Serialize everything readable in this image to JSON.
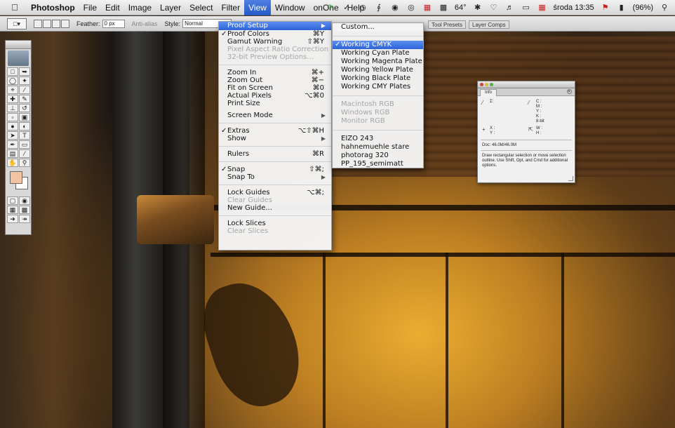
{
  "menubar": {
    "app_name": "Photoshop",
    "menus": [
      "File",
      "Edit",
      "Image",
      "Layer",
      "Select",
      "Filter",
      "View",
      "Window",
      "onOne",
      "Help"
    ],
    "active_menu": "View",
    "status": {
      "temperature": "64°",
      "clock": "środa 13:35",
      "battery": "(96%)"
    }
  },
  "options_bar": {
    "feather_label": "Feather:",
    "feather_value": "0 px",
    "antialias_label": "Anti-alias",
    "style_label": "Style:",
    "style_value": "Normal",
    "palette_tabs": [
      "Tool Presets",
      "Layer Comps"
    ]
  },
  "view_menu": {
    "items": [
      {
        "label": "Proof Setup",
        "shortcut": "",
        "submenu": true,
        "selected": true
      },
      {
        "label": "Proof Colors",
        "shortcut": "⌘Y",
        "checked": true
      },
      {
        "label": "Gamut Warning",
        "shortcut": "⇧⌘Y"
      },
      {
        "label": "Pixel Aspect Ratio Correction",
        "disabled": true
      },
      {
        "label": "32-bit Preview Options...",
        "disabled": true
      },
      {
        "sep": true
      },
      {
        "label": "Zoom In",
        "shortcut": "⌘+"
      },
      {
        "label": "Zoom Out",
        "shortcut": "⌘−"
      },
      {
        "label": "Fit on Screen",
        "shortcut": "⌘0"
      },
      {
        "label": "Actual Pixels",
        "shortcut": "⌥⌘0"
      },
      {
        "label": "Print Size"
      },
      {
        "gap": true
      },
      {
        "label": "Screen Mode",
        "submenu": true
      },
      {
        "sep": true
      },
      {
        "label": "Extras",
        "shortcut": "⌥⇧⌘H",
        "checked": true
      },
      {
        "label": "Show",
        "submenu": true
      },
      {
        "sep": true
      },
      {
        "label": "Rulers",
        "shortcut": "⌘R"
      },
      {
        "sep": true
      },
      {
        "label": "Snap",
        "shortcut": "⇧⌘;",
        "checked": true
      },
      {
        "label": "Snap To",
        "submenu": true
      },
      {
        "sep": true
      },
      {
        "label": "Lock Guides",
        "shortcut": "⌥⌘;"
      },
      {
        "label": "Clear Guides",
        "disabled": true
      },
      {
        "label": "New Guide..."
      },
      {
        "sep": true
      },
      {
        "label": "Lock Slices"
      },
      {
        "label": "Clear Slices",
        "disabled": true
      }
    ]
  },
  "proof_setup_submenu": {
    "items": [
      {
        "label": "Custom..."
      },
      {
        "sep": true
      },
      {
        "label": "Working CMYK",
        "checked": true,
        "selected": true
      },
      {
        "label": "Working Cyan Plate"
      },
      {
        "label": "Working Magenta Plate"
      },
      {
        "label": "Working Yellow Plate"
      },
      {
        "label": "Working Black Plate"
      },
      {
        "label": "Working CMY Plates"
      },
      {
        "sep": true
      },
      {
        "label": "Macintosh RGB",
        "disabled": true
      },
      {
        "label": "Windows RGB",
        "disabled": true
      },
      {
        "label": "Monitor RGB",
        "disabled": true
      },
      {
        "sep": true
      },
      {
        "label": "EIZO 243"
      },
      {
        "label": "hahnemuehle stare"
      },
      {
        "label": "photorag 320"
      },
      {
        "label": "PP_195_semimatt"
      }
    ]
  },
  "info_panel": {
    "tab": "Info",
    "cmyk_labels": "C :\nM :\nY :\nK :",
    "bit_depth": "8-bit",
    "doc": "Doc: 46.0M/46.0M",
    "hint": "Draw rectangular selection or move selection outline. Use Shift, Opt, and Cmd for additional options."
  },
  "tools": {
    "foreground_color": "#f2c4a2",
    "background_color": "#ffffff"
  }
}
